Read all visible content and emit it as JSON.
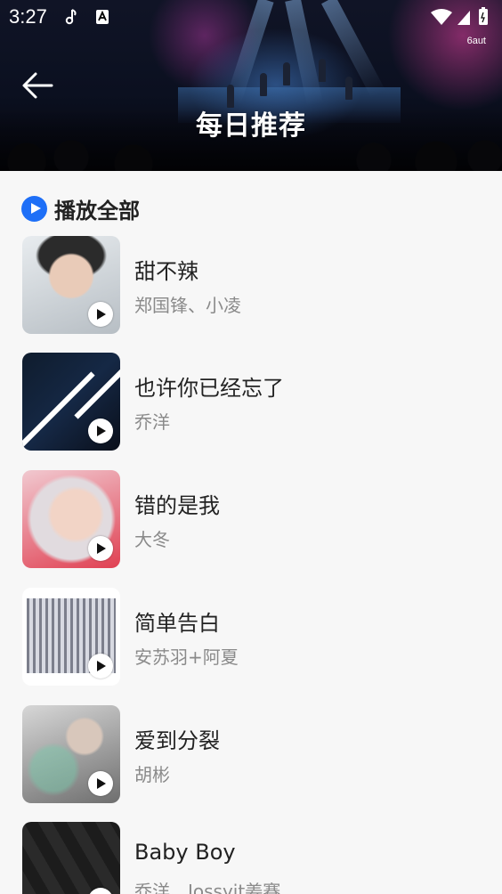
{
  "status_bar": {
    "time": "3:27",
    "carrier": "6aut"
  },
  "header": {
    "title": "每日推荐"
  },
  "play_all": {
    "label": "播放全部"
  },
  "songs": [
    {
      "title": "甜不辣",
      "artist": "郑国锋、小凌"
    },
    {
      "title": "也许你已经忘了",
      "artist": "乔洋"
    },
    {
      "title": "错的是我",
      "artist": "大冬"
    },
    {
      "title": "简单告白",
      "artist": "安苏羽+阿夏"
    },
    {
      "title": "爱到分裂",
      "artist": "胡彬"
    },
    {
      "title": "Baby Boy",
      "artist": "乔洋、Jossyit姜赛"
    }
  ],
  "colors": {
    "accent": "#1e6ff7",
    "title_text": "#222222",
    "secondary_text": "#8a8a8a",
    "background": "#f7f7f7"
  }
}
